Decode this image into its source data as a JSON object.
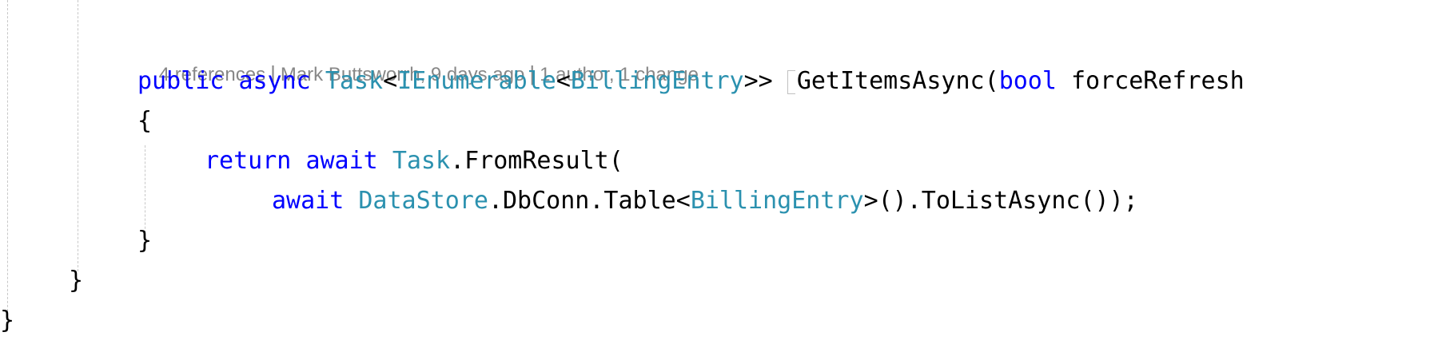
{
  "codelens": {
    "references": "4 references",
    "author_info": "Mark Buttsworrh, 9 days ago",
    "changes": "1 author, 1 change",
    "separator": "|"
  },
  "code": {
    "line1": {
      "public_kw": "public",
      "async_kw": "async",
      "task_type": "Task",
      "lt1": "<",
      "ienum_type": "IEnumerable",
      "lt2": "<",
      "billing_type": "BillingEntry",
      "gt": ">>",
      "method": "GetItemsAsync(",
      "bool_kw": "bool",
      "param": "forceRefresh"
    },
    "line2": {
      "brace": "{"
    },
    "line3": {
      "return_kw": "return",
      "await_kw": "await",
      "task_type": "Task",
      "call": ".FromResult("
    },
    "line4": {
      "await_kw": "await",
      "datastore_type": "DataStore",
      "dbconn": ".DbConn.Table<",
      "billing_type": "BillingEntry",
      "tail": ">().ToListAsync());"
    },
    "line5": {
      "brace": "}"
    },
    "line6": {
      "brace": "}"
    },
    "line7": {
      "brace": "}"
    }
  }
}
